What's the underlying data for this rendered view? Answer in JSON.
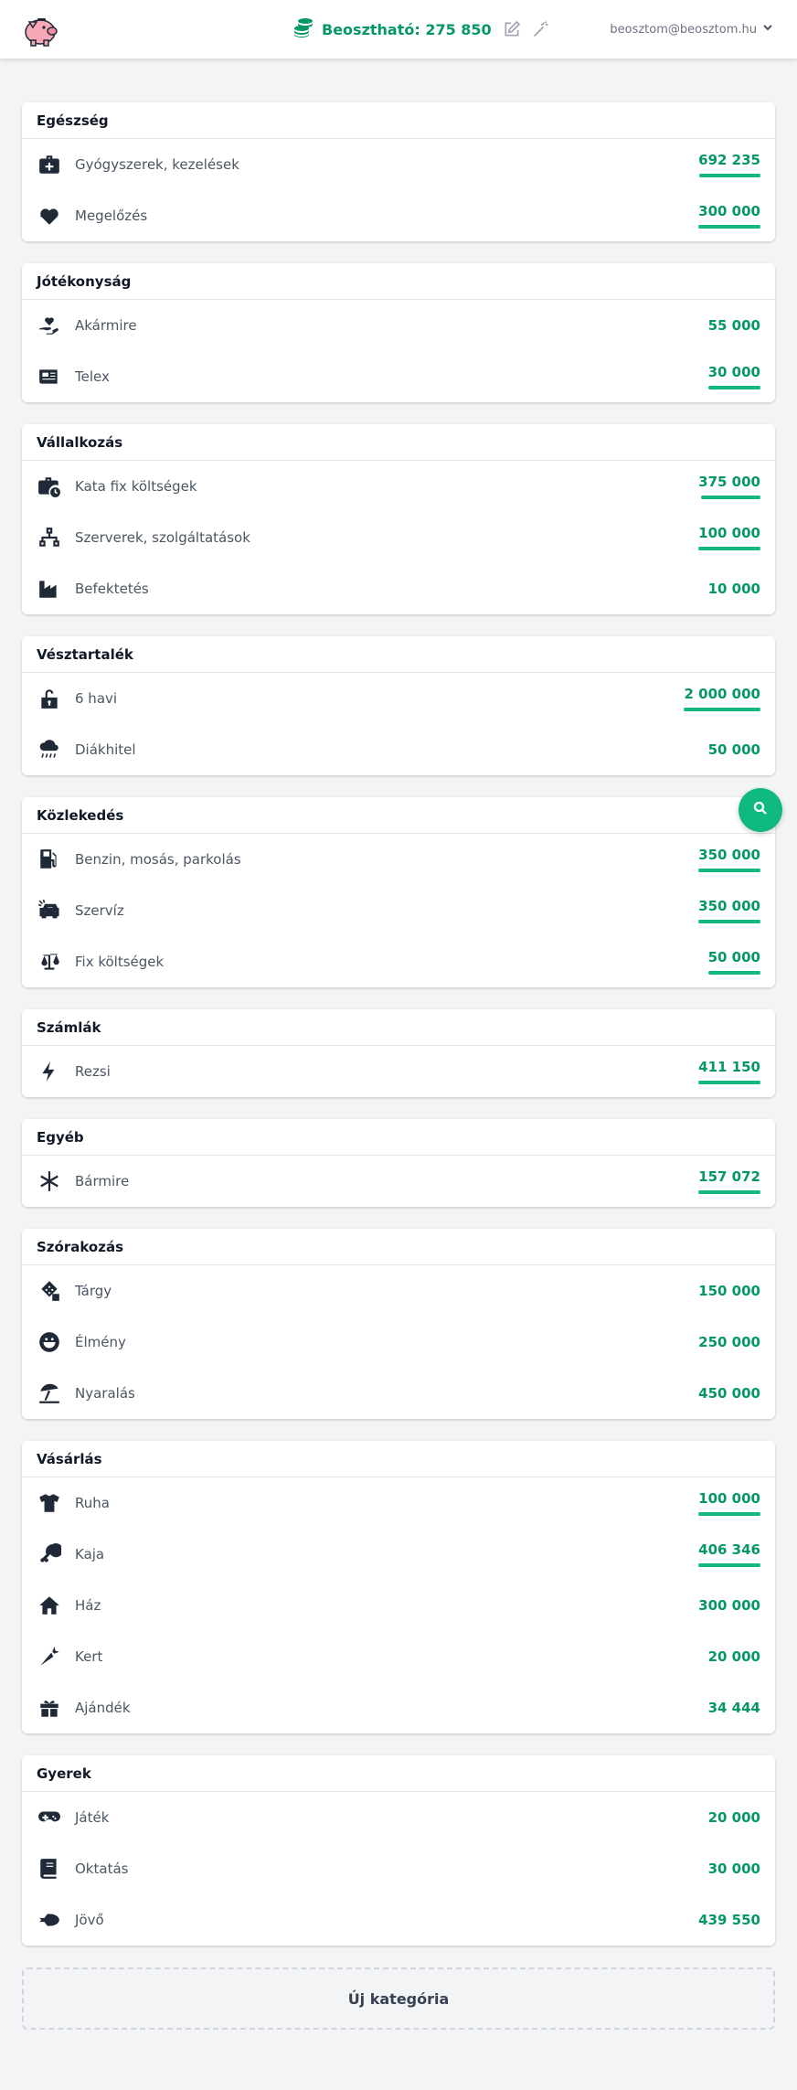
{
  "header": {
    "budget_label": "Beosztható: 275 850",
    "account_email": "beosztom@beosztom.hu"
  },
  "colors": {
    "accent": "#059669",
    "accent_bar": "#10b981",
    "background": "#f3f4f6"
  },
  "categories": [
    {
      "title": "Egészség",
      "items": [
        {
          "icon": "first-aid-kit-icon",
          "label": "Gyógyszerek, kezelések",
          "amount": "692 235",
          "spent_fraction": 0.98
        },
        {
          "icon": "heartbeat-icon",
          "label": "Megelőzés",
          "amount": "300 000",
          "spent_fraction": 1.0
        }
      ]
    },
    {
      "title": "Jótékonyság",
      "items": [
        {
          "icon": "hand-holding-heart-icon",
          "label": "Akármire",
          "amount": "55 000",
          "spent_fraction": 0
        },
        {
          "icon": "newspaper-icon",
          "label": "Telex",
          "amount": "30 000",
          "spent_fraction": 1.0
        }
      ]
    },
    {
      "title": "Vállalkozás",
      "items": [
        {
          "icon": "briefcase-clock-icon",
          "label": "Kata fix költségek",
          "amount": "375 000",
          "spent_fraction": 0.95
        },
        {
          "icon": "network-icon",
          "label": "Szerverek, szolgáltatások",
          "amount": "100 000",
          "spent_fraction": 1.0
        },
        {
          "icon": "industry-icon",
          "label": "Befektetés",
          "amount": "10 000",
          "spent_fraction": 0
        }
      ]
    },
    {
      "title": "Vésztartalék",
      "items": [
        {
          "icon": "unlock-icon",
          "label": "6 havi",
          "amount": "2 000 000",
          "spent_fraction": 1.0
        },
        {
          "icon": "cloud-rain-icon",
          "label": "Diákhitel",
          "amount": "50 000",
          "spent_fraction": 0
        }
      ]
    },
    {
      "title": "Közlekedés",
      "items": [
        {
          "icon": "gas-pump-icon",
          "label": "Benzin, mosás, parkolás",
          "amount": "350 000",
          "spent_fraction": 1.0
        },
        {
          "icon": "car-crash-icon",
          "label": "Szervíz",
          "amount": "350 000",
          "spent_fraction": 1.0
        },
        {
          "icon": "balance-scale-icon",
          "label": "Fix költségek",
          "amount": "50 000",
          "spent_fraction": 1.0
        }
      ]
    },
    {
      "title": "Számlák",
      "items": [
        {
          "icon": "bolt-icon",
          "label": "Rezsi",
          "amount": "411 150",
          "spent_fraction": 1.0
        }
      ]
    },
    {
      "title": "Egyéb",
      "items": [
        {
          "icon": "asterisk-icon",
          "label": "Bármire",
          "amount": "157 072",
          "spent_fraction": 1.0
        }
      ]
    },
    {
      "title": "Szórakozás",
      "items": [
        {
          "icon": "dice-icon",
          "label": "Tárgy",
          "amount": "150 000",
          "spent_fraction": 0
        },
        {
          "icon": "grin-icon",
          "label": "Élmény",
          "amount": "250 000",
          "spent_fraction": 0
        },
        {
          "icon": "umbrella-beach-icon",
          "label": "Nyaralás",
          "amount": "450 000",
          "spent_fraction": 0
        }
      ]
    },
    {
      "title": "Vásárlás",
      "items": [
        {
          "icon": "tshirt-icon",
          "label": "Ruha",
          "amount": "100 000",
          "spent_fraction": 1.0
        },
        {
          "icon": "drumstick-icon",
          "label": "Kaja",
          "amount": "406 346",
          "spent_fraction": 1.0
        },
        {
          "icon": "home-icon",
          "label": "Ház",
          "amount": "300 000",
          "spent_fraction": 0
        },
        {
          "icon": "carrot-icon",
          "label": "Kert",
          "amount": "20 000",
          "spent_fraction": 0
        },
        {
          "icon": "gift-icon",
          "label": "Ajándék",
          "amount": "34 444",
          "spent_fraction": 0
        }
      ]
    },
    {
      "title": "Gyerek",
      "items": [
        {
          "icon": "gamepad-icon",
          "label": "Játék",
          "amount": "20 000",
          "spent_fraction": 0
        },
        {
          "icon": "book-icon",
          "label": "Oktatás",
          "amount": "30 000",
          "spent_fraction": 0
        },
        {
          "icon": "space-shuttle-icon",
          "label": "Jövő",
          "amount": "439 550",
          "spent_fraction": 0
        }
      ]
    }
  ],
  "new_category_label": "Új kategória"
}
